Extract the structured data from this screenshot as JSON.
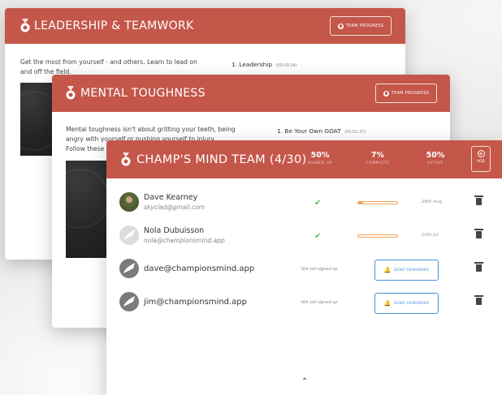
{
  "cards": {
    "leadership": {
      "title": "LEADERSHIP & TEAMWORK",
      "progress_button": "TEAM PROGRESS",
      "description": "Get the most from yourself - and others. Learn to lead on and off the field.",
      "lesson": {
        "title": "1. Leadership",
        "duration": "(00:09:34)"
      }
    },
    "mental": {
      "title": "MENTAL TOUGHNESS",
      "progress_button": "TEAM PROGRESS",
      "description": "Mental toughness isn't about gritting your teeth, being angry with yourself or pushing yourself to injury. Follow these guidelin",
      "lesson": {
        "title": "1. Be Your Own GOAT",
        "duration": "(00:01:37)"
      }
    },
    "team": {
      "title": "CHAMP'S MIND TEAM (4/30)",
      "stats": [
        {
          "value": "50%",
          "label": "SIGNED UP"
        },
        {
          "value": "7%",
          "label": "COMPLETE"
        },
        {
          "value": "50%",
          "label": "ACTIVE"
        }
      ],
      "add_label": "ADD",
      "members": [
        {
          "name": "Dave Kearney",
          "email": "skyclad@gmail.com",
          "signed_up": true,
          "progress_fraction": 0.12,
          "date": "28th Aug"
        },
        {
          "name": "Nola Dubuisson",
          "email": "nola@championsmind.app",
          "signed_up": true,
          "progress_fraction": 0.0,
          "date": "10th Jul"
        }
      ],
      "invites": [
        {
          "email": "dave@championsmind.app",
          "status": "Not yet signed up",
          "button": "SEND REMINDER"
        },
        {
          "email": "jim@championsmind.app",
          "status": "Not yet signed up",
          "button": "SEND REMINDER"
        }
      ]
    }
  },
  "colors": {
    "header": "#c4574a",
    "accent_blue": "#4a90d9",
    "progress_orange": "#f0a35e",
    "check_green": "#5cb85c"
  }
}
